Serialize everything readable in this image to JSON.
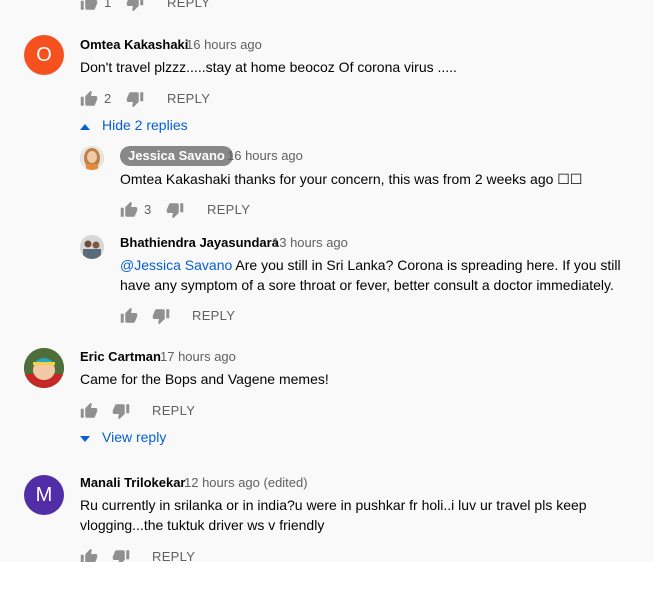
{
  "top_actions": {
    "likes": "1",
    "reply_label": "REPLY"
  },
  "comments": [
    {
      "avatar_letter": "O",
      "avatar_color": "#f4511e",
      "author": "Omtea Kakashaki",
      "time": "16 hours ago",
      "text": "Don't travel plzzz.....stay at home beocoz Of corona virus .....",
      "likes": "2",
      "reply_label": "REPLY",
      "toggle": "Hide 2 replies",
      "replies": [
        {
          "author": "Jessica Savano",
          "time": "16 hours ago",
          "text": "Omtea Kakashaki thanks for your concern, this was from 2 weeks ago ☐☐",
          "likes": "3",
          "reply_label": "REPLY"
        },
        {
          "author": "Bhathiendra Jayasundara",
          "time": "13 hours ago",
          "mention": "@Jessica Savano",
          "text_line1": " Are you still in Sri Lanka? Corona is spreading here. If you still",
          "text_line2": "have any symptom of a sore throat or fever, better consult a doctor immediately.",
          "reply_label": "REPLY"
        }
      ]
    },
    {
      "author": "Eric Cartman",
      "time": "17 hours ago",
      "text": "Came for the Bops and Vagene memes!",
      "reply_label": "REPLY",
      "toggle": "View reply"
    },
    {
      "avatar_letter": "M",
      "avatar_color": "#512da8",
      "author": "Manali Trilokekar",
      "time": "12 hours ago (edited)",
      "text_line1": "Ru currently in srilanka or in india?u were in pushkar fr holi..i luv ur travel pls keep",
      "text_line2": "vlogging...the tuktuk driver ws v friendly",
      "reply_label": "REPLY"
    }
  ],
  "colors": {
    "link": "#065fd4",
    "secondary_text": "#606060",
    "chip_bg": "#888888",
    "background": "#f9f9f9"
  },
  "icons": {
    "like": "thumb-up-icon",
    "dislike": "thumb-down-icon",
    "collapse": "caret-up-icon",
    "expand": "caret-down-icon"
  }
}
